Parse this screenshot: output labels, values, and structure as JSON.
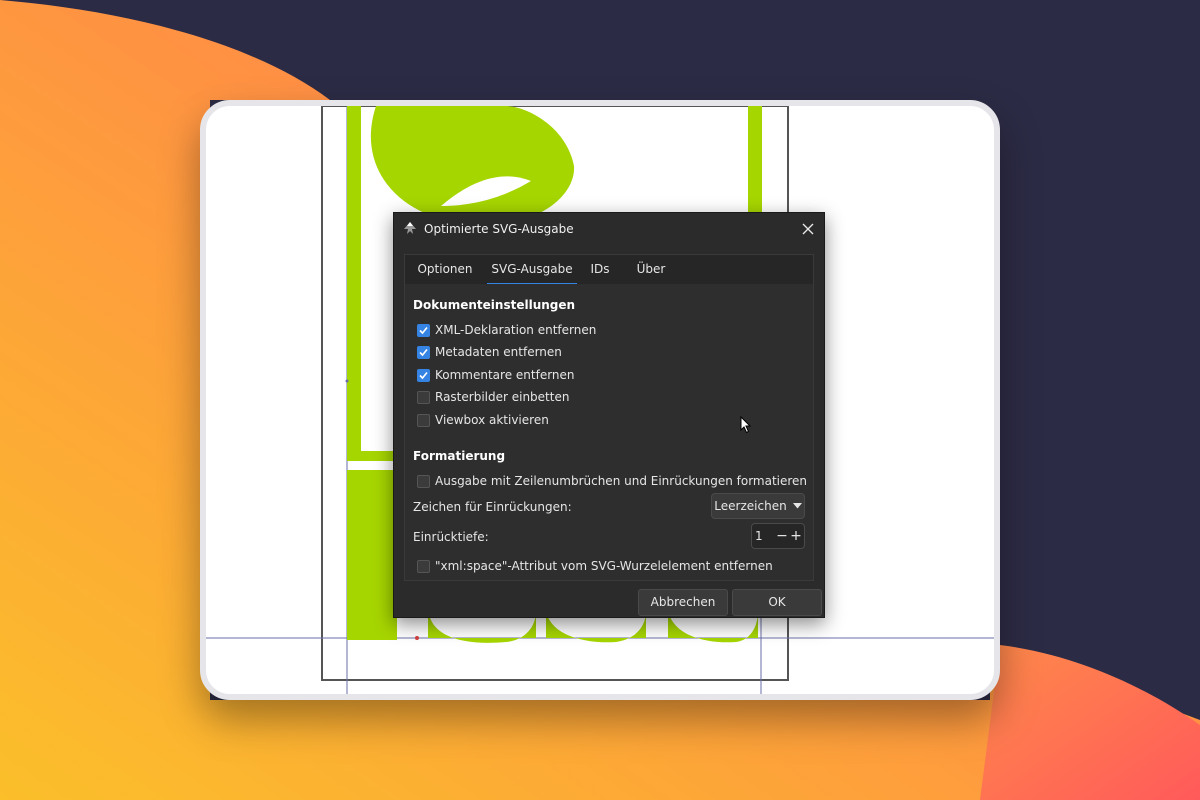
{
  "colors": {
    "background": "#2c2b45",
    "accent": "#3584e4",
    "leaf_green": "#a6d600",
    "dialog_bg": "#2b2b2b",
    "orange_start": "#fbbf2a",
    "orange_end": "#ff5f5a"
  },
  "dialog": {
    "title": "Optimierte SVG-Ausgabe",
    "app_icon": "inkscape-icon",
    "close_icon": "close-icon",
    "tabs": [
      {
        "label": "Optionen",
        "active": false
      },
      {
        "label": "SVG-Ausgabe",
        "active": true
      },
      {
        "label": "IDs",
        "active": false
      },
      {
        "label": "Über",
        "active": false
      }
    ],
    "document_section": {
      "title": "Dokumenteinstellungen",
      "options": [
        {
          "label": "XML-Deklaration entfernen",
          "checked": true
        },
        {
          "label": "Metadaten entfernen",
          "checked": true
        },
        {
          "label": "Kommentare entfernen",
          "checked": true
        },
        {
          "label": "Rasterbilder einbetten",
          "checked": false
        },
        {
          "label": "Viewbox aktivieren",
          "checked": false
        }
      ]
    },
    "format_section": {
      "title": "Formatierung",
      "format_option": {
        "label": "Ausgabe mit Zeilenumbrüchen und Einrückungen formatieren",
        "checked": false
      },
      "indent_char_label": "Zeichen für Einrückungen:",
      "indent_char_value": "Leerzeichen",
      "indent_depth_label": "Einrücktiefe:",
      "indent_depth_value": "1",
      "spin_minus": "−",
      "spin_plus": "+",
      "xmlspace_option": {
        "label": "\"xml:space\"-Attribut vom SVG-Wurzelelement entfernen",
        "checked": false
      }
    },
    "buttons": {
      "cancel": "Abbrechen",
      "ok": "OK"
    }
  }
}
